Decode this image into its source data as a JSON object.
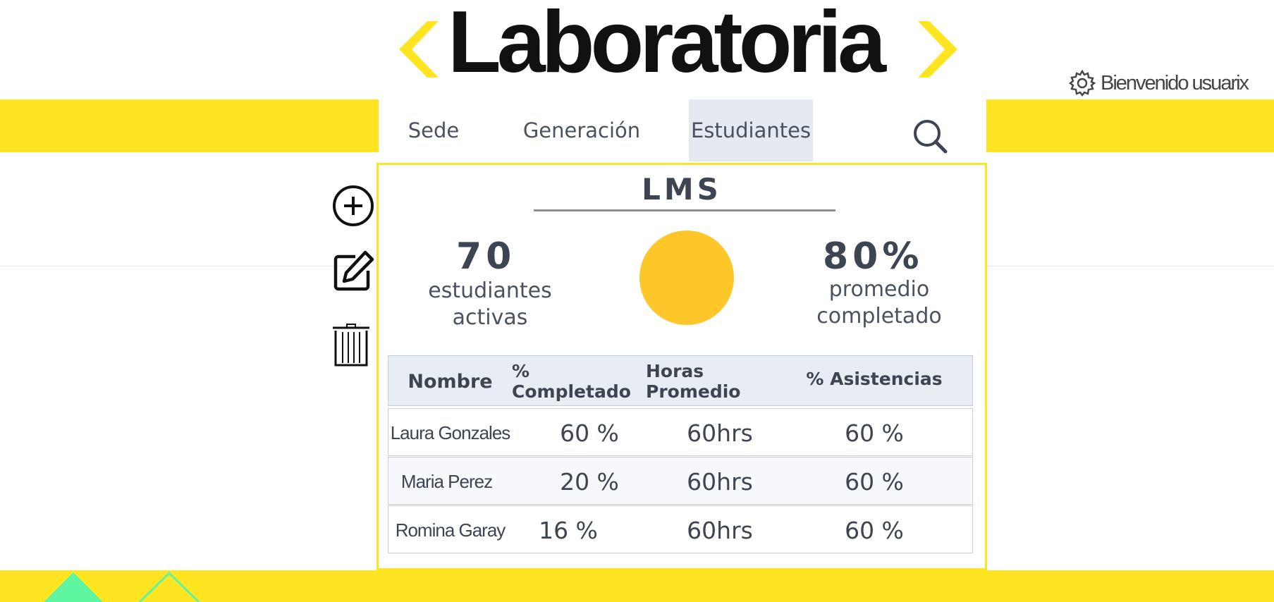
{
  "app": {
    "logo_text": "Laboratoria",
    "user_label": "Bienvenido usuarix",
    "icons": {
      "settings": "gear-icon",
      "search": "search-icon",
      "add": "plus-circle-icon",
      "edit": "edit-icon",
      "delete": "trash-icon"
    }
  },
  "nav": {
    "items": [
      {
        "label": "Sede"
      },
      {
        "label": "Generación"
      },
      {
        "label": "Estudiantes",
        "active": true
      }
    ]
  },
  "panel": {
    "title": "LMS",
    "stats": {
      "active_count": "70",
      "active_label": "estudiantes activas",
      "avg_value": "80%",
      "avg_label_line1": "promedio",
      "avg_label_line2": "completado"
    },
    "table": {
      "headers": [
        "Nombre",
        "% Completado",
        "Horas Promedio",
        "% Asistencias"
      ],
      "rows": [
        [
          "Laura Gonzales",
          "60 %",
          "60hrs",
          "60 %"
        ],
        [
          "Maria Perez",
          "20 %",
          "60hrs",
          "60 %"
        ],
        [
          "Romina Garay",
          "16 %",
          "60hrs",
          "60 %"
        ]
      ]
    }
  },
  "colors": {
    "brand_yellow": "#ffe521",
    "donut": "#fdc72a",
    "nav_active": "#e4e9f2",
    "accent_green": "#5ef5a0"
  }
}
